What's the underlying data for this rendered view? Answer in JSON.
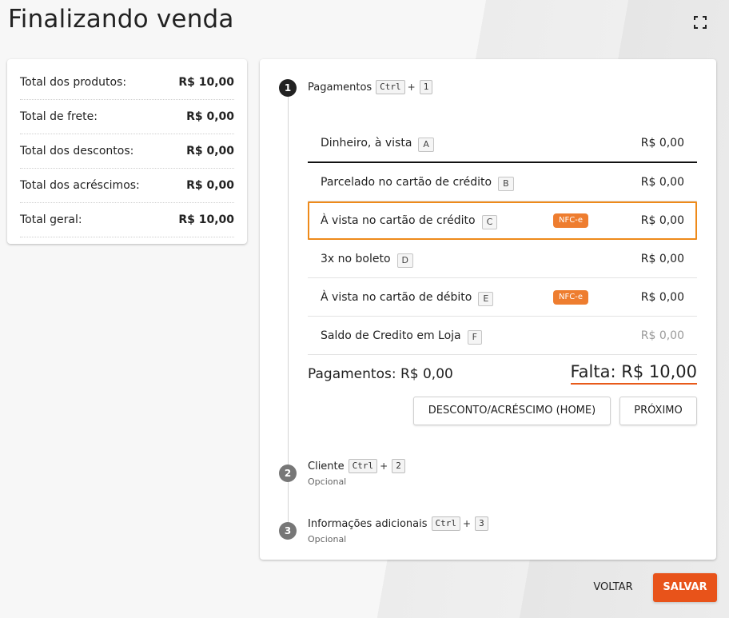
{
  "page": {
    "title": "Finalizando venda"
  },
  "summary": {
    "rows": [
      {
        "label": "Total dos produtos:",
        "value": "R$ 10,00"
      },
      {
        "label": "Total de frete:",
        "value": "R$ 0,00"
      },
      {
        "label": "Total dos descontos:",
        "value": "R$ 0,00"
      },
      {
        "label": "Total dos acréscimos:",
        "value": "R$ 0,00"
      },
      {
        "label": "Total geral:",
        "value": "R$ 10,00"
      }
    ]
  },
  "steps": [
    {
      "number": "1",
      "label": "Pagamentos",
      "kbd1": "Ctrl",
      "plus": "+",
      "kbd2": "1"
    },
    {
      "number": "2",
      "label": "Cliente",
      "kbd1": "Ctrl",
      "plus": "+",
      "kbd2": "2",
      "sub": "Opcional"
    },
    {
      "number": "3",
      "label": "Informações adicionais",
      "kbd1": "Ctrl",
      "plus": "+",
      "kbd2": "3",
      "sub": "Opcional"
    }
  ],
  "payments": [
    {
      "name": "Dinheiro, à vista",
      "key": "A",
      "amount": "R$ 0,00"
    },
    {
      "name": "Parcelado no cartão de crédito",
      "key": "B",
      "amount": "R$ 0,00"
    },
    {
      "name": "À vista no cartão de crédito",
      "key": "C",
      "amount": "R$ 0,00",
      "badge": "NFC-e"
    },
    {
      "name": "3x no boleto",
      "key": "D",
      "amount": "R$ 0,00"
    },
    {
      "name": "À vista no cartão de débito",
      "key": "E",
      "amount": "R$ 0,00",
      "badge": "NFC-e"
    },
    {
      "name": "Saldo de Credito em Loja",
      "key": "F",
      "amount": "R$ 0,00"
    }
  ],
  "totals": {
    "pagamentos": "Pagamentos: R$ 0,00",
    "falta": "Falta: R$ 10,00"
  },
  "buttons": {
    "desconto": "DESCONTO/ACRÉSCIMO (HOME)",
    "proximo": "PRÓXIMO",
    "voltar": "VOLTAR",
    "salvar": "SALVAR"
  },
  "icons": {
    "fullscreen": "fullscreen-icon"
  },
  "colors": {
    "accent": "#e8531a",
    "badge": "#ee7d2f",
    "focus": "#ee8a1a"
  }
}
